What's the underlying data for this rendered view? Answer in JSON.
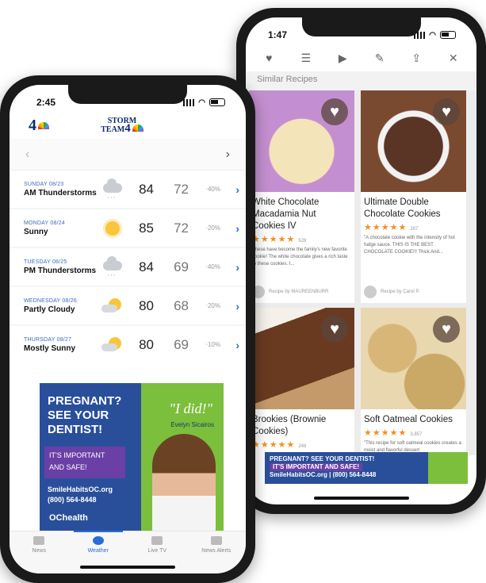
{
  "left_phone": {
    "time": "2:45",
    "logo": "4",
    "brand_top": "STORM",
    "brand_bottom": "TEAM",
    "brand_num": "4",
    "nav_prev": "‹",
    "nav_next": "›",
    "forecast": [
      {
        "date": "SUNDAY 08/23",
        "cond": "AM Thunderstorms",
        "hi": "84",
        "lo": "72",
        "pct": "40%",
        "icon": "thunder-cloud-icon"
      },
      {
        "date": "MONDAY 08/24",
        "cond": "Sunny",
        "hi": "85",
        "lo": "72",
        "pct": "20%",
        "icon": "sun-icon"
      },
      {
        "date": "TUESDAY 08/25",
        "cond": "PM Thunderstorms",
        "hi": "84",
        "lo": "69",
        "pct": "40%",
        "icon": "thunder-cloud-icon"
      },
      {
        "date": "WEDNESDAY 08/26",
        "cond": "Partly Cloudy",
        "hi": "80",
        "lo": "68",
        "pct": "20%",
        "icon": "partly-cloudy-icon"
      },
      {
        "date": "THURSDAY 08/27",
        "cond": "Mostly Sunny",
        "hi": "80",
        "lo": "69",
        "pct": "10%",
        "icon": "mostly-sunny-icon"
      }
    ],
    "ad": {
      "headline1": "PREGNANT?",
      "headline2": "SEE YOUR",
      "headline3": "DENTIST!",
      "box1": "IT'S IMPORTANT",
      "box2": "AND SAFE!",
      "url": "SmileHabitsOC.org",
      "phone": "(800) 564-8448",
      "quote": "\"I did!\"",
      "name": "Evelyn Sicairos",
      "org": "OChealth"
    },
    "tabs": [
      {
        "label": "News",
        "icon": "news-icon"
      },
      {
        "label": "Weather",
        "icon": "weather-icon"
      },
      {
        "label": "Live TV",
        "icon": "tv-icon"
      },
      {
        "label": "News Alerts",
        "icon": "bell-icon"
      }
    ]
  },
  "right_phone": {
    "time": "1:47",
    "toolbar": [
      "♥",
      "☰",
      "▶",
      "✎",
      "⇪",
      "✕"
    ],
    "section_title": "Similar Recipes",
    "recipes": [
      {
        "title": "White Chocolate Macadamia Nut Cookies IV",
        "rating_count": "528",
        "desc": "These have become the family's new favorite cookie! The white chocolate gives a rich taste to these cookies. I...",
        "by": "Recipe by MAUREENBURR",
        "img": "#f2e3b7"
      },
      {
        "title": "Ultimate Double Chocolate Cookies",
        "rating_count": "287",
        "desc": "\"A chocolate cookie with the intensity of hot fudge sauce. THIS IS THE BEST CHOCOLATE COOKIE!!! Thick And...",
        "by": "Recipe by Carol P.",
        "img": "#5a3424"
      },
      {
        "title": "Brookies (Brownie Cookies)",
        "rating_count": "248",
        "desc": "",
        "by": "",
        "img": "#6a3a20"
      },
      {
        "title": "Soft Oatmeal Cookies",
        "rating_count": "3,857",
        "desc": "\"This recipe for soft oatmeal cookies creates a moist and flavorful dessert",
        "by": "",
        "img": "#d7b678"
      }
    ],
    "ad": {
      "line1": "PREGNANT? SEE YOUR DENTIST!",
      "line2": "IT'S IMPORTANT AND SAFE!",
      "line3": "SmileHabitsOC.org | (800) 564-8448"
    }
  }
}
